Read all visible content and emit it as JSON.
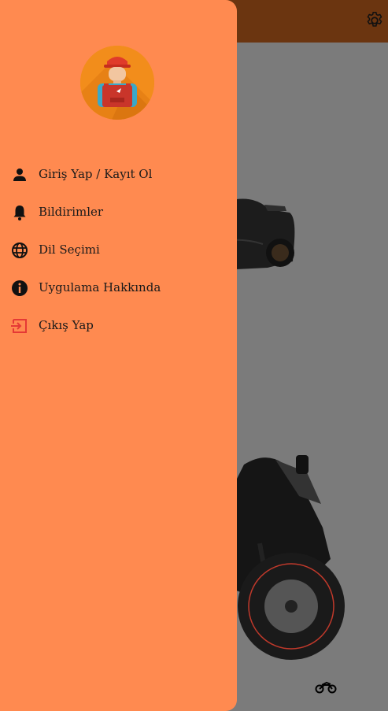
{
  "app_bar": {
    "settings_icon": "settings-gear-icon",
    "color": "#6b3510"
  },
  "drawer": {
    "background": "#ff8a50",
    "avatar_icon": "mechanic-avatar",
    "items": [
      {
        "label": "Giriş Yap / Kayıt Ol",
        "icon": "person-icon"
      },
      {
        "label": "Bildirimler",
        "icon": "bell-icon"
      },
      {
        "label": "Dil Seçimi",
        "icon": "globe-icon"
      },
      {
        "label": "Uygulama Hakkında",
        "icon": "info-icon"
      },
      {
        "label": "Çıkış Yap",
        "icon": "logout-icon",
        "icon_color": "#e53935"
      }
    ]
  },
  "background_content": {
    "car_image": "black-sports-car",
    "motorcycle_image": "black-sport-motorcycle",
    "vehicle_type_icon": "motorcycle-icon"
  }
}
